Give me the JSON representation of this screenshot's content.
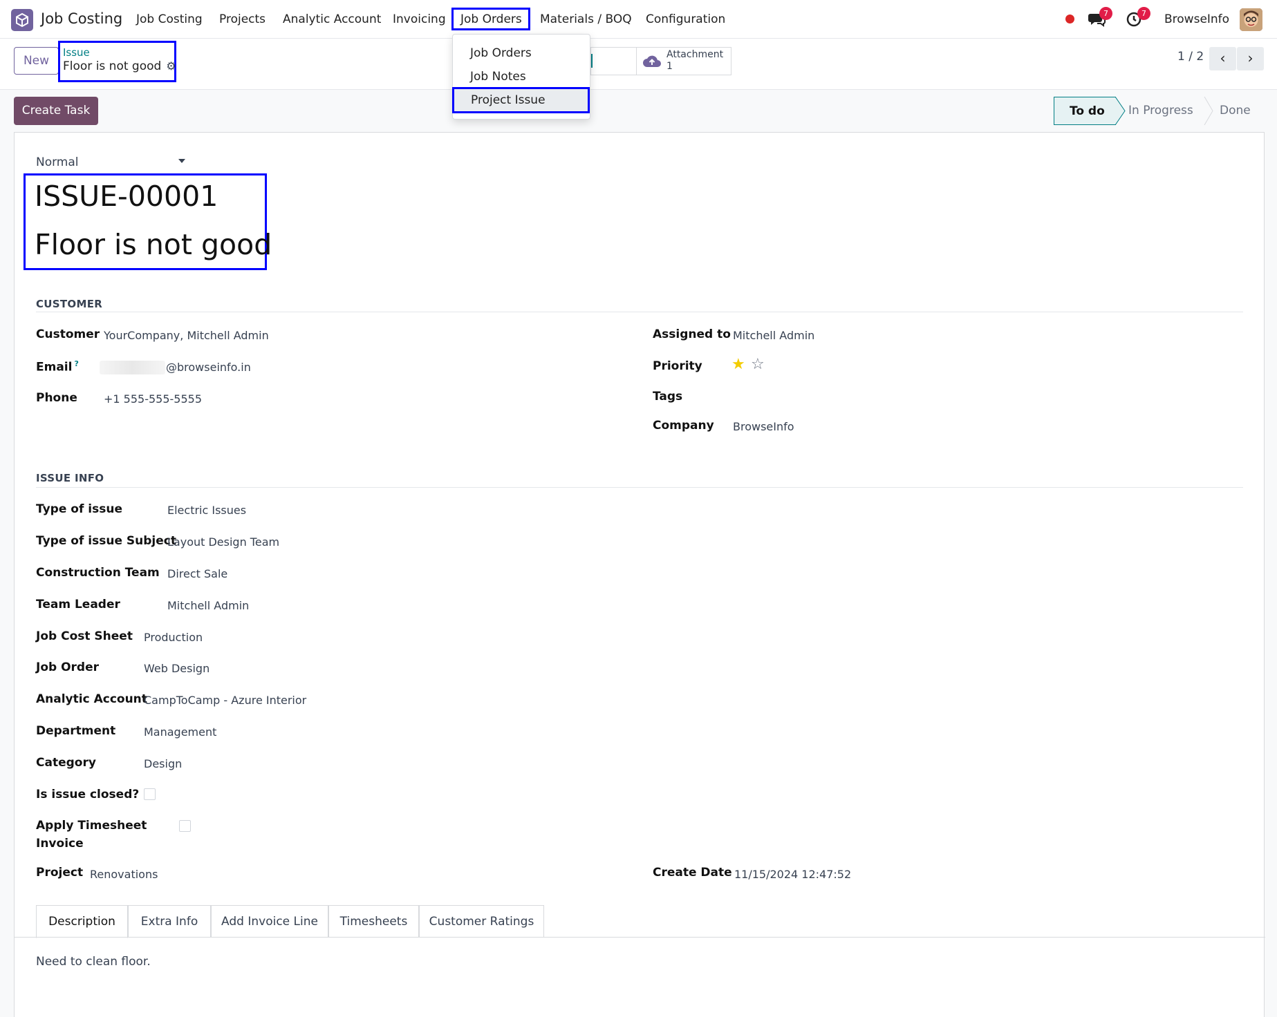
{
  "nav": {
    "app_name": "Job Costing",
    "menu": [
      "Job Costing",
      "Projects",
      "Analytic Account",
      "Invoicing",
      "Job Orders",
      "Materials / BOQ",
      "Configuration"
    ],
    "active_menu": "Job Orders",
    "messages_badge": "7",
    "activities_badge": "7",
    "company": "BrowseInfo"
  },
  "control": {
    "new_label": "New",
    "breadcrumb_parent": "Issue",
    "breadcrumb_current": "Floor is not good",
    "attachment_label": "Attachment",
    "attachment_count": "1",
    "pager": "1 / 2"
  },
  "dropdown": {
    "items": [
      "Job Orders",
      "Job Notes",
      "Project Issue"
    ],
    "highlighted": "Project Issue"
  },
  "actions": {
    "create_task": "Create Task"
  },
  "status": {
    "stages": [
      "To do",
      "In Progress",
      "Done"
    ],
    "current": "To do"
  },
  "form": {
    "priority_select": "Normal",
    "reference": "ISSUE-00001",
    "name": "Floor is not good",
    "customer_section": "CUSTOMER",
    "customer_label": "Customer",
    "customer": "YourCompany, Mitchell Admin",
    "email_label": "Email",
    "email_help": "?",
    "email": "@browseinfo.in",
    "phone_label": "Phone",
    "phone": "+1 555-555-5555",
    "assigned_label": "Assigned to",
    "assigned": "Mitchell Admin",
    "priority_label": "Priority",
    "priority_stars": 1,
    "priority_max": 2,
    "tags_label": "Tags",
    "company_label": "Company",
    "company": "BrowseInfo",
    "issue_section": "ISSUE INFO",
    "type_issue_label": "Type of issue",
    "type_issue": "Electric Issues",
    "type_subject_label": "Type of issue Subject",
    "type_subject": "Layout Design Team",
    "team_label": "Construction Team",
    "team": "Direct Sale",
    "leader_label": "Team Leader",
    "leader": "Mitchell Admin",
    "cost_sheet_label": "Job Cost Sheet",
    "cost_sheet": "Production",
    "job_order_label": "Job Order",
    "job_order": "Web Design",
    "analytic_label": "Analytic Account",
    "analytic": "CampToCamp - Azure Interior",
    "department_label": "Department",
    "department": "Management",
    "category_label": "Category",
    "category": "Design",
    "closed_label": "Is issue closed?",
    "closed": false,
    "timesheet_label_1": "Apply Timesheet",
    "timesheet_label_2": "Invoice",
    "timesheet": false,
    "project_label": "Project",
    "project": "Renovations",
    "create_date_label": "Create Date",
    "create_date": "11/15/2024 12:47:52"
  },
  "tabs": [
    "Description",
    "Extra Info",
    "Add Invoice Line",
    "Timesheets",
    "Customer Ratings"
  ],
  "active_tab": "Description",
  "description": "Need to clean floor.",
  "colors": {
    "brand": "#714b67",
    "teal": "#017e84",
    "highlight_box": "#0000ff",
    "badge": "#e11d48",
    "star": "#f3cc00"
  }
}
